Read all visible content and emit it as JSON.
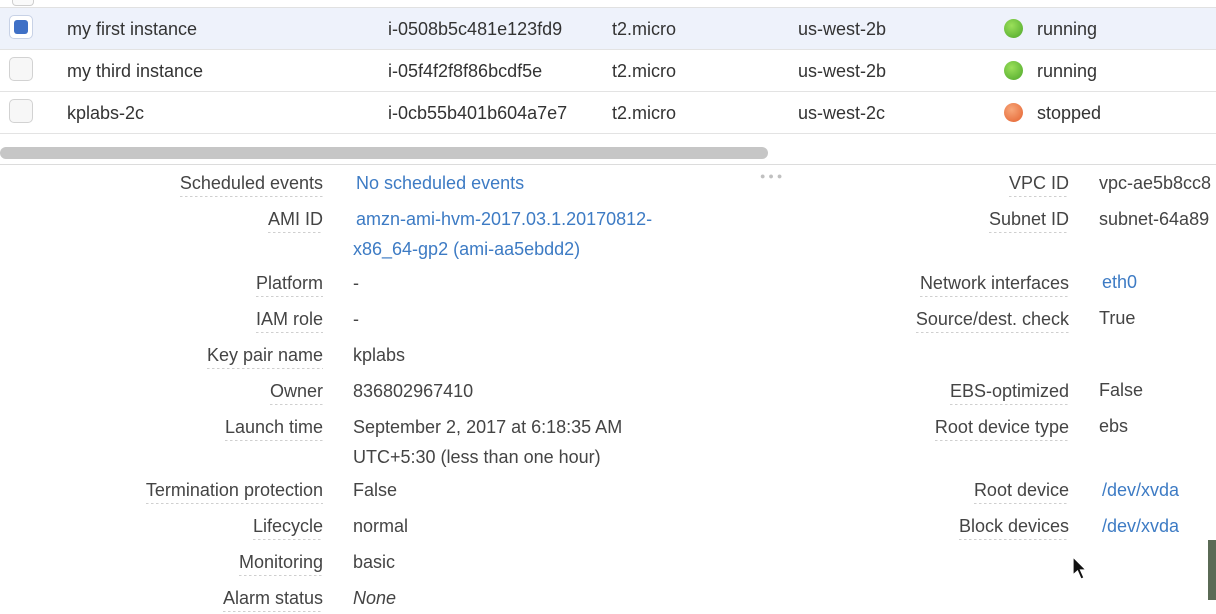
{
  "instances": {
    "rows": [
      {
        "name": "my first instance",
        "id": "i-0508b5c481e123fd9",
        "type": "t2.micro",
        "az": "us-west-2b",
        "state": "running",
        "selected": true
      },
      {
        "name": "my third instance",
        "id": "i-05f4f2f8f86bcdf5e",
        "type": "t2.micro",
        "az": "us-west-2b",
        "state": "running",
        "selected": false
      },
      {
        "name": "kplabs-2c",
        "id": "i-0cb55b401b604a7e7",
        "type": "t2.micro",
        "az": "us-west-2c",
        "state": "stopped",
        "selected": false
      }
    ],
    "colors": {
      "running": "#5cb83a",
      "stopped": "#e8703d",
      "selected_bg": "#eef2fb",
      "link": "#3d7bc4"
    }
  },
  "details": {
    "left": [
      {
        "label": "Scheduled events",
        "value": "No scheduled events",
        "link": true
      },
      {
        "label": "AMI ID",
        "value_line1": "amzn-ami-hvm-2017.03.1.20170812-",
        "value_line2": "x86_64-gp2 (ami-aa5ebdd2)",
        "link": true
      },
      {
        "label": "Platform",
        "value": "-"
      },
      {
        "label": "IAM role",
        "value": "-"
      },
      {
        "label": "Key pair name",
        "value": "kplabs"
      },
      {
        "label": "Owner",
        "value": "836802967410"
      },
      {
        "label": "Launch time",
        "value_line1": "September 2, 2017 at 6:18:35 AM",
        "value_line2": "UTC+5:30 (less than one hour)"
      },
      {
        "label": "Termination protection",
        "value": "False"
      },
      {
        "label": "Lifecycle",
        "value": "normal"
      },
      {
        "label": "Monitoring",
        "value": "basic"
      },
      {
        "label": "Alarm status",
        "value": "None",
        "italic": true
      }
    ],
    "right": [
      {
        "label": "VPC ID",
        "value": "vpc-ae5b8cc8"
      },
      {
        "label": "Subnet ID",
        "value": "subnet-64a89"
      },
      {
        "label": "Network interfaces",
        "value": "eth0",
        "link": true
      },
      {
        "label": "Source/dest. check",
        "value": "True"
      },
      {
        "label": "EBS-optimized",
        "value": "False"
      },
      {
        "label": "Root device type",
        "value": "ebs"
      },
      {
        "label": "Root device",
        "value": "/dev/xvda",
        "link": true
      },
      {
        "label": "Block devices",
        "value": "/dev/xvda",
        "link": true
      }
    ]
  }
}
